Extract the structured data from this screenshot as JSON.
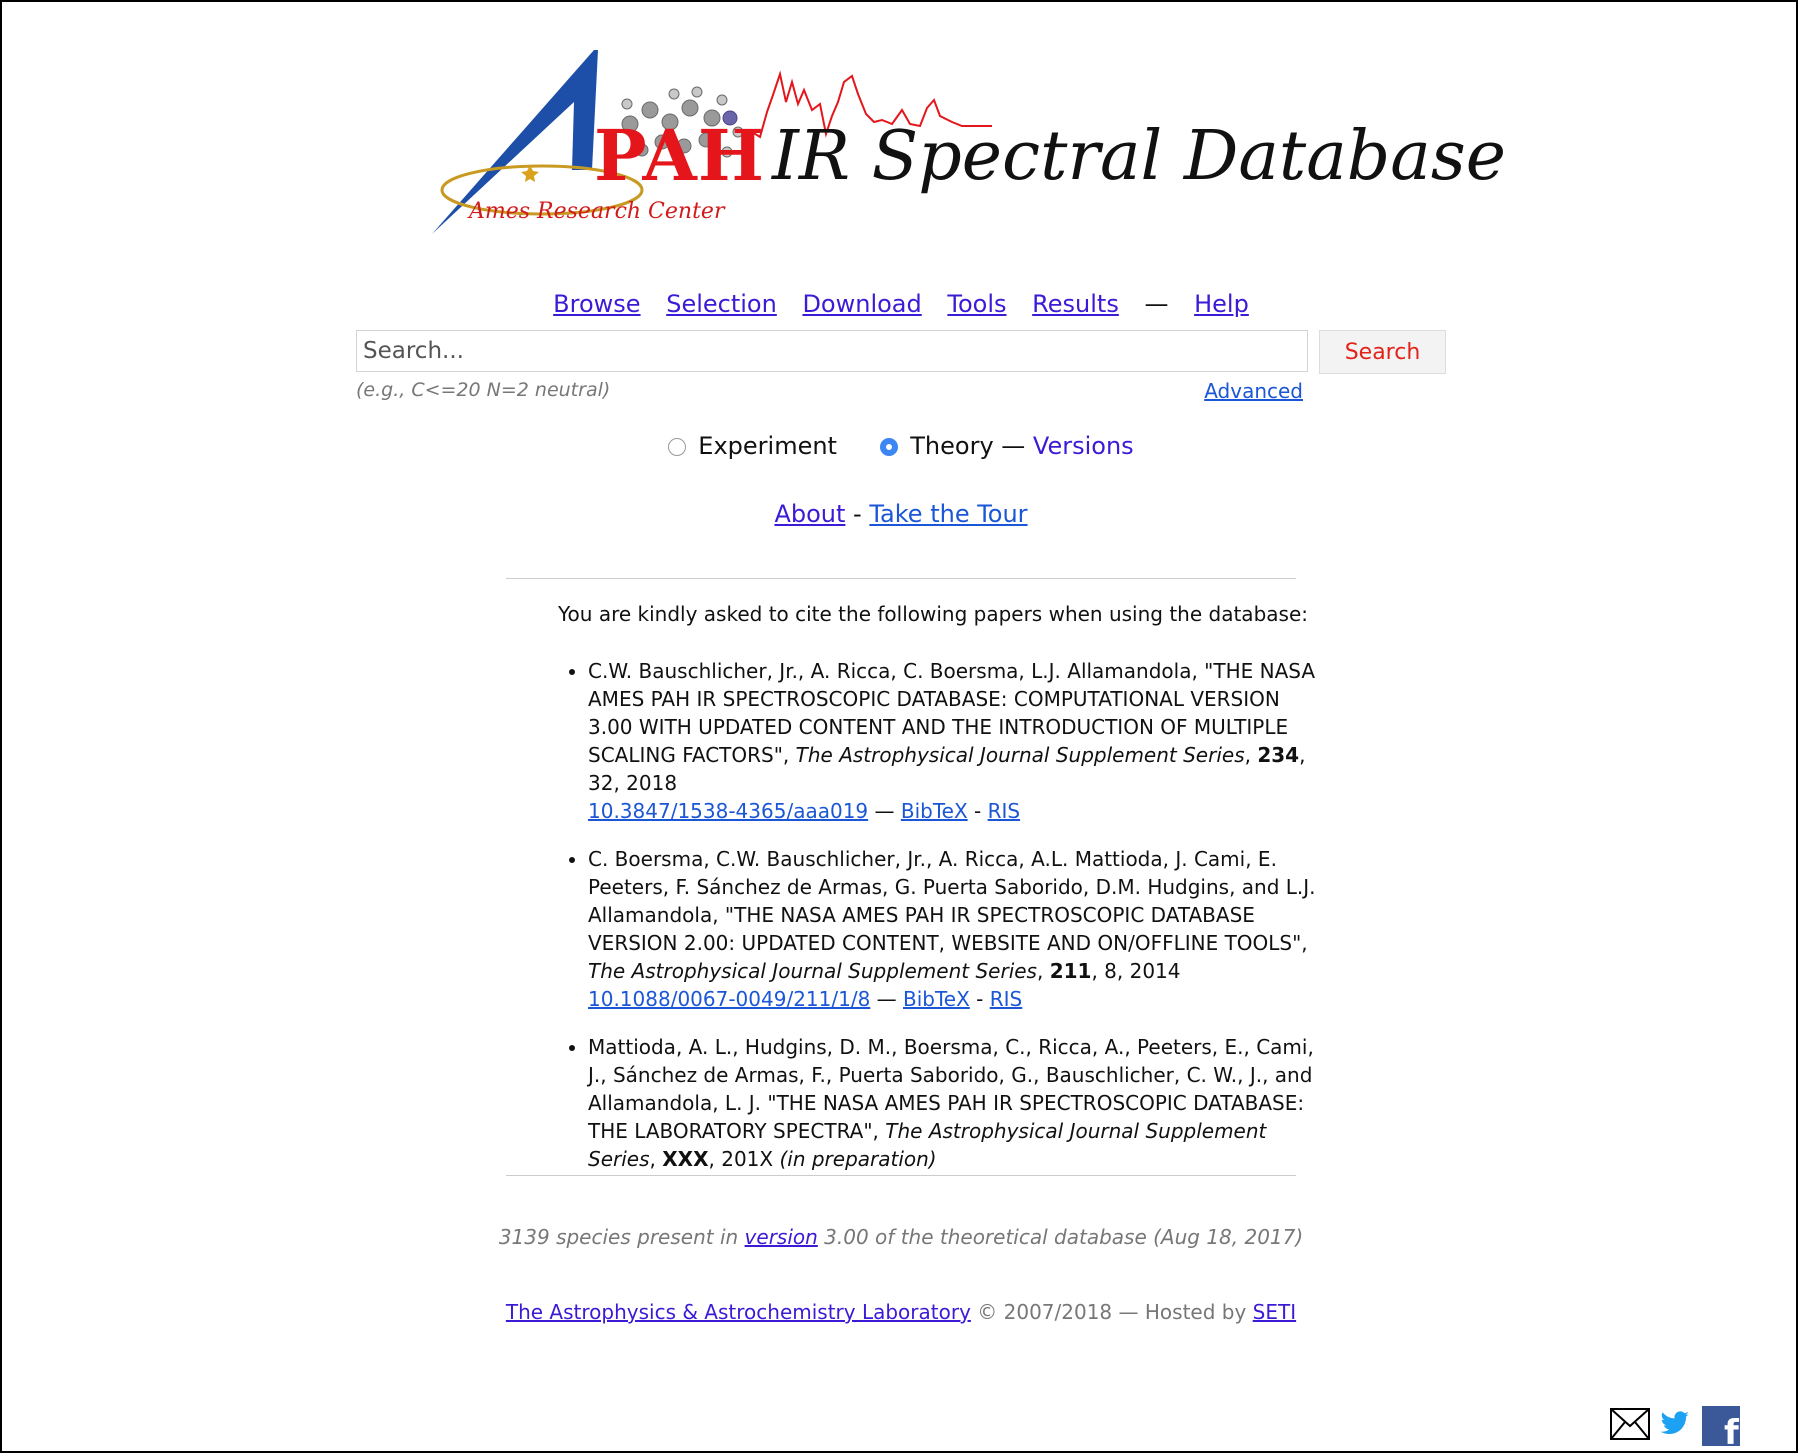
{
  "logo": {
    "pah": "PAH",
    "title": "IR Spectral Database",
    "ames": "Ames Research Center"
  },
  "nav": {
    "browse": "Browse",
    "selection": "Selection",
    "download": "Download",
    "tools": "Tools",
    "results": "Results",
    "separator": "—",
    "help": "Help"
  },
  "search": {
    "placeholder": "Search...",
    "button": "Search",
    "hint": "(e.g., C<=20 N=2 neutral)",
    "advanced": "Advanced"
  },
  "dataset": {
    "experiment": "Experiment",
    "theory": "Theory",
    "dash": "—",
    "versions": "Versions",
    "selected": "Theory"
  },
  "links": {
    "about": "About",
    "sep": "-",
    "tour": "Take the Tour"
  },
  "citations": {
    "intro": "You are kindly asked to cite the following papers when using the database:",
    "items": [
      {
        "text": "C.W. Bauschlicher, Jr., A. Ricca, C. Boersma, L.J. Allamandola, \"THE NASA AMES PAH IR SPECTROSCOPIC DATABASE: COMPUTATIONAL VERSION 3.00 WITH UPDATED CONTENT AND THE INTRODUCTION OF MULTIPLE SCALING FACTORS\", ",
        "journal": "The Astrophysical Journal Supplement Series",
        "volume": "234",
        "rest": ", 32, 2018",
        "doi": "10.3847/1538-4365/aaa019",
        "bibtex": "BibTeX",
        "ris": "RIS"
      },
      {
        "text": "C. Boersma, C.W. Bauschlicher, Jr., A. Ricca, A.L. Mattioda, J. Cami, E. Peeters, F. Sánchez de Armas, G. Puerta Saborido, D.M. Hudgins, and L.J. Allamandola, \"THE NASA AMES PAH IR SPECTROSCOPIC DATABASE VERSION 2.00: UPDATED CONTENT, WEBSITE AND ON/OFFLINE TOOLS\", ",
        "journal": "The Astrophysical Journal Supplement Series",
        "volume": "211",
        "rest": ", 8, 2014 ",
        "doi": "10.1088/0067-0049/211/1/8",
        "bibtex": "BibTeX",
        "ris": "RIS"
      },
      {
        "text": "Mattioda, A. L., Hudgins, D. M., Boersma, C., Ricca, A., Peeters, E., Cami, J., Sánchez de Armas, F., Puerta Saborido, G., Bauschlicher, C. W., J., and Allamandola, L. J. \"THE NASA AMES PAH IR SPECTROSCOPIC DATABASE: THE LABORATORY SPECTRA\", ",
        "journal": "The Astrophysical Journal Supplement Series",
        "volume": "XXX",
        "rest": ", 201X ",
        "note": "(in preparation)"
      }
    ],
    "em_dash": " — ",
    "dash": " - "
  },
  "footer": {
    "species_pre": "3139 species present in ",
    "version_link": "version",
    "species_post": " 3.00 of the theoretical database (Aug 18, 2017)",
    "lab_link": "The Astrophysics & Astrochemistry Laboratory",
    "copyright": " © 2007/2018 — Hosted by ",
    "seti_link": "SETI"
  },
  "social": {
    "icons": [
      "mail-icon",
      "twitter-icon",
      "facebook-icon"
    ],
    "facebook_glyph": "f"
  },
  "colors": {
    "link": "#3c1ad6",
    "link_blue": "#1a56d6",
    "pah_red": "#e4161b",
    "search_red": "#e2231a",
    "nasa_blue": "#1e4fa8",
    "radio_blue": "#3d87f5"
  }
}
